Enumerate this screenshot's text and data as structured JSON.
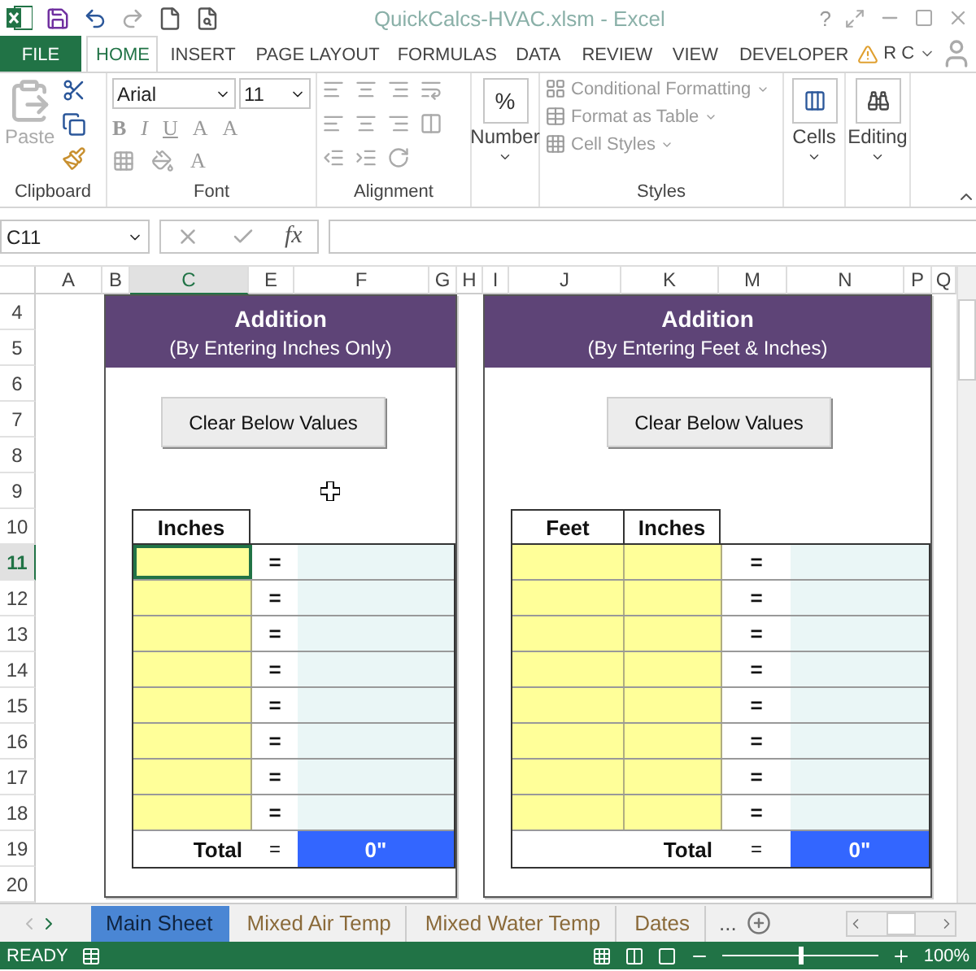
{
  "window": {
    "title": "QuickCalcs-HVAC.xlsm - Excel",
    "help": "?"
  },
  "ribbon_tabs": [
    {
      "label": "FILE",
      "kind": "file",
      "selected": false
    },
    {
      "label": "HOME",
      "kind": "tab",
      "selected": true
    },
    {
      "label": "INSERT",
      "kind": "tab",
      "selected": false
    },
    {
      "label": "PAGE LAYOUT",
      "kind": "tab",
      "selected": false
    },
    {
      "label": "FORMULAS",
      "kind": "tab",
      "selected": false
    },
    {
      "label": "DATA",
      "kind": "tab",
      "selected": false
    },
    {
      "label": "REVIEW",
      "kind": "tab",
      "selected": false
    },
    {
      "label": "VIEW",
      "kind": "tab",
      "selected": false
    },
    {
      "label": "DEVELOPER",
      "kind": "tab",
      "selected": false
    }
  ],
  "account": {
    "name": "R C"
  },
  "ribbon": {
    "paste": "Paste",
    "font_name": "Arial",
    "font_size": "11",
    "font_buttons": [
      "B",
      "I",
      "U"
    ],
    "grow_font": "A",
    "shrink_font": "A",
    "font_color": "A",
    "number_symbol": "%",
    "number": "Number",
    "styles": [
      {
        "label": "Conditional Formatting",
        "disabled": true
      },
      {
        "label": "Format as Table",
        "disabled": true
      },
      {
        "label": "Cell Styles",
        "disabled": true
      }
    ],
    "cells": "Cells",
    "editing": "Editing",
    "group_labels": [
      "Clipboard",
      "Font",
      "Alignment",
      "Styles"
    ]
  },
  "formula_bar": {
    "name_box": "C11",
    "function_label": "fx"
  },
  "columns": [
    {
      "label": "A",
      "selected": false
    },
    {
      "label": "B",
      "selected": false
    },
    {
      "label": "C",
      "selected": true
    },
    {
      "label": "E",
      "selected": false
    },
    {
      "label": "F",
      "selected": false
    },
    {
      "label": "G",
      "selected": false
    },
    {
      "label": "H",
      "selected": false
    },
    {
      "label": "I",
      "selected": false
    },
    {
      "label": "J",
      "selected": false
    },
    {
      "label": "K",
      "selected": false
    },
    {
      "label": "M",
      "selected": false
    },
    {
      "label": "N",
      "selected": false
    },
    {
      "label": "P",
      "selected": false
    },
    {
      "label": "Q",
      "selected": false
    }
  ],
  "rows": [
    {
      "label": "4",
      "selected": false
    },
    {
      "label": "5",
      "selected": false
    },
    {
      "label": "6",
      "selected": false
    },
    {
      "label": "7",
      "selected": false
    },
    {
      "label": "8",
      "selected": false
    },
    {
      "label": "9",
      "selected": false
    },
    {
      "label": "10",
      "selected": false
    },
    {
      "label": "11",
      "selected": true
    },
    {
      "label": "12",
      "selected": false
    },
    {
      "label": "13",
      "selected": false
    },
    {
      "label": "14",
      "selected": false
    },
    {
      "label": "15",
      "selected": false
    },
    {
      "label": "16",
      "selected": false
    },
    {
      "label": "17",
      "selected": false
    },
    {
      "label": "18",
      "selected": false
    },
    {
      "label": "19",
      "selected": false
    },
    {
      "label": "20",
      "selected": false
    }
  ],
  "panels": [
    {
      "title": "Addition",
      "subtitle": "(By Entering Inches Only)",
      "button": "Clear Below Values",
      "input_columns": [
        "Inches"
      ],
      "rows": [
        {
          "equals": "=",
          "selected": true
        },
        {
          "equals": "=",
          "selected": false
        },
        {
          "equals": "=",
          "selected": false
        },
        {
          "equals": "=",
          "selected": false
        },
        {
          "equals": "=",
          "selected": false
        },
        {
          "equals": "=",
          "selected": false
        },
        {
          "equals": "=",
          "selected": false
        },
        {
          "equals": "=",
          "selected": false
        }
      ],
      "total": {
        "label": "Total",
        "equals": "=",
        "value": "0\""
      }
    },
    {
      "title": "Addition",
      "subtitle": "(By Entering Feet & Inches)",
      "button": "Clear Below Values",
      "input_columns": [
        "Feet",
        "Inches"
      ],
      "rows": [
        {
          "equals": "=",
          "selected": false
        },
        {
          "equals": "=",
          "selected": false
        },
        {
          "equals": "=",
          "selected": false
        },
        {
          "equals": "=",
          "selected": false
        },
        {
          "equals": "=",
          "selected": false
        },
        {
          "equals": "=",
          "selected": false
        },
        {
          "equals": "=",
          "selected": false
        },
        {
          "equals": "=",
          "selected": false
        }
      ],
      "total": {
        "label": "Total",
        "equals": "=",
        "value": "0\""
      }
    }
  ],
  "sheet_tabs": [
    {
      "label": "Main Sheet",
      "selected": true
    },
    {
      "label": "Mixed Air Temp",
      "selected": false
    },
    {
      "label": "Mixed Water Temp",
      "selected": false
    },
    {
      "label": "Dates",
      "selected": false
    }
  ],
  "more_sheets": "...",
  "status_bar": {
    "mode": "READY",
    "zoom": "100%",
    "level": 0.5
  }
}
